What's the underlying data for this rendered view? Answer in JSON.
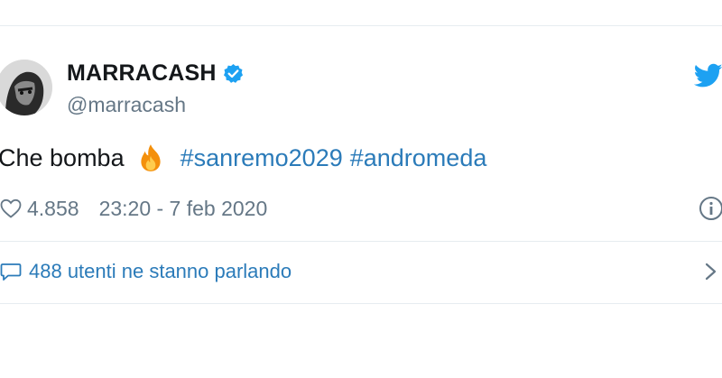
{
  "tweet": {
    "author": {
      "display_name": "MARRACASH",
      "handle": "@marracash",
      "verified": true,
      "avatar_icon": "profile-photo"
    },
    "text_prefix": "Che bomba",
    "emoji": "fire-icon",
    "hashtags": [
      "#sanremo2029",
      "#andromeda"
    ],
    "likes": "4.858",
    "timestamp": "23:20 - 7 feb 2020",
    "conversation_label": "488 utenti ne stanno parlando"
  },
  "colors": {
    "link": "#2b7bb9",
    "muted": "#657786",
    "twitter_blue": "#1da1f2",
    "border": "#e6ecf0"
  },
  "icons": {
    "brand": "twitter-bird-icon",
    "verified": "verified-badge-icon",
    "like": "heart-icon",
    "info": "info-icon",
    "reply": "speech-bubble-icon",
    "more": "chevron-right-icon"
  }
}
